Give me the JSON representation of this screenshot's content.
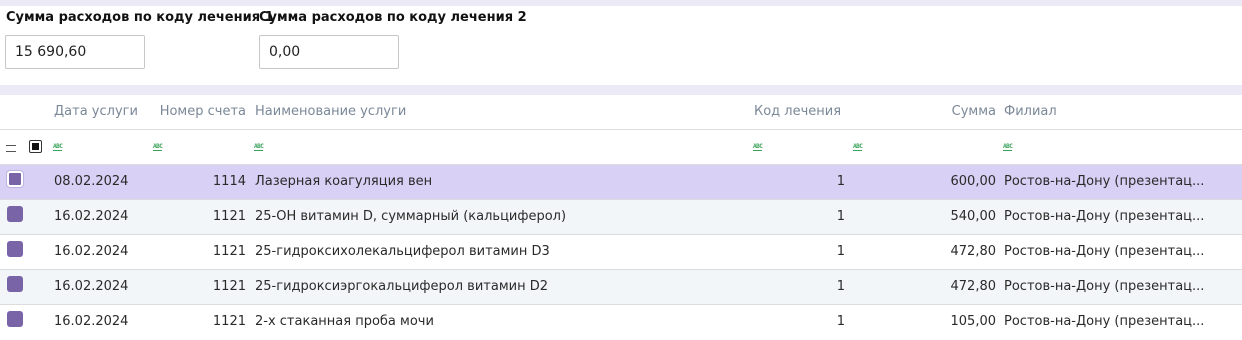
{
  "summary": {
    "code1_label": "Сумма расходов по коду лечения 1",
    "code1_value": "15 690,60",
    "code2_label": "Сумма расходов по коду лечения 2",
    "code2_value": "0,00"
  },
  "table": {
    "columns": {
      "date": "Дата услуги",
      "account": "Номер счета",
      "service": "Наименование услуги",
      "code": "Код лечения",
      "sum": "Сумма",
      "branch": "Филиал"
    },
    "filter_icon_label": "ABC",
    "rows": [
      {
        "date": "08.02.2024",
        "account": "1114",
        "service": "Лазерная коагуляция вен",
        "code": "1",
        "sum": "600,00",
        "branch": "Ростов-на-Дону (презентац..."
      },
      {
        "date": "16.02.2024",
        "account": "1121",
        "service": "25-ОН витамин D, суммарный (кальциферол)",
        "code": "1",
        "sum": "540,00",
        "branch": "Ростов-на-Дону (презентац..."
      },
      {
        "date": "16.02.2024",
        "account": "1121",
        "service": "25-гидроксихолекальциферол витамин D3",
        "code": "1",
        "sum": "472,80",
        "branch": "Ростов-на-Дону (презентац..."
      },
      {
        "date": "16.02.2024",
        "account": "1121",
        "service": "25-гидроксиэргокальциферол витамин D2",
        "code": "1",
        "sum": "472,80",
        "branch": "Ростов-на-Дону (презентац..."
      },
      {
        "date": "16.02.2024",
        "account": "1121",
        "service": "2-х стаканная проба мочи",
        "code": "1",
        "sum": "105,00",
        "branch": "Ростов-на-Дону (презентац..."
      }
    ]
  },
  "colors": {
    "accent": "#7a64a8",
    "selected_row": "#d8d1f5",
    "alt_row": "#f3f6f8",
    "header_text": "#7b8898",
    "strip": "#edeaf8"
  }
}
